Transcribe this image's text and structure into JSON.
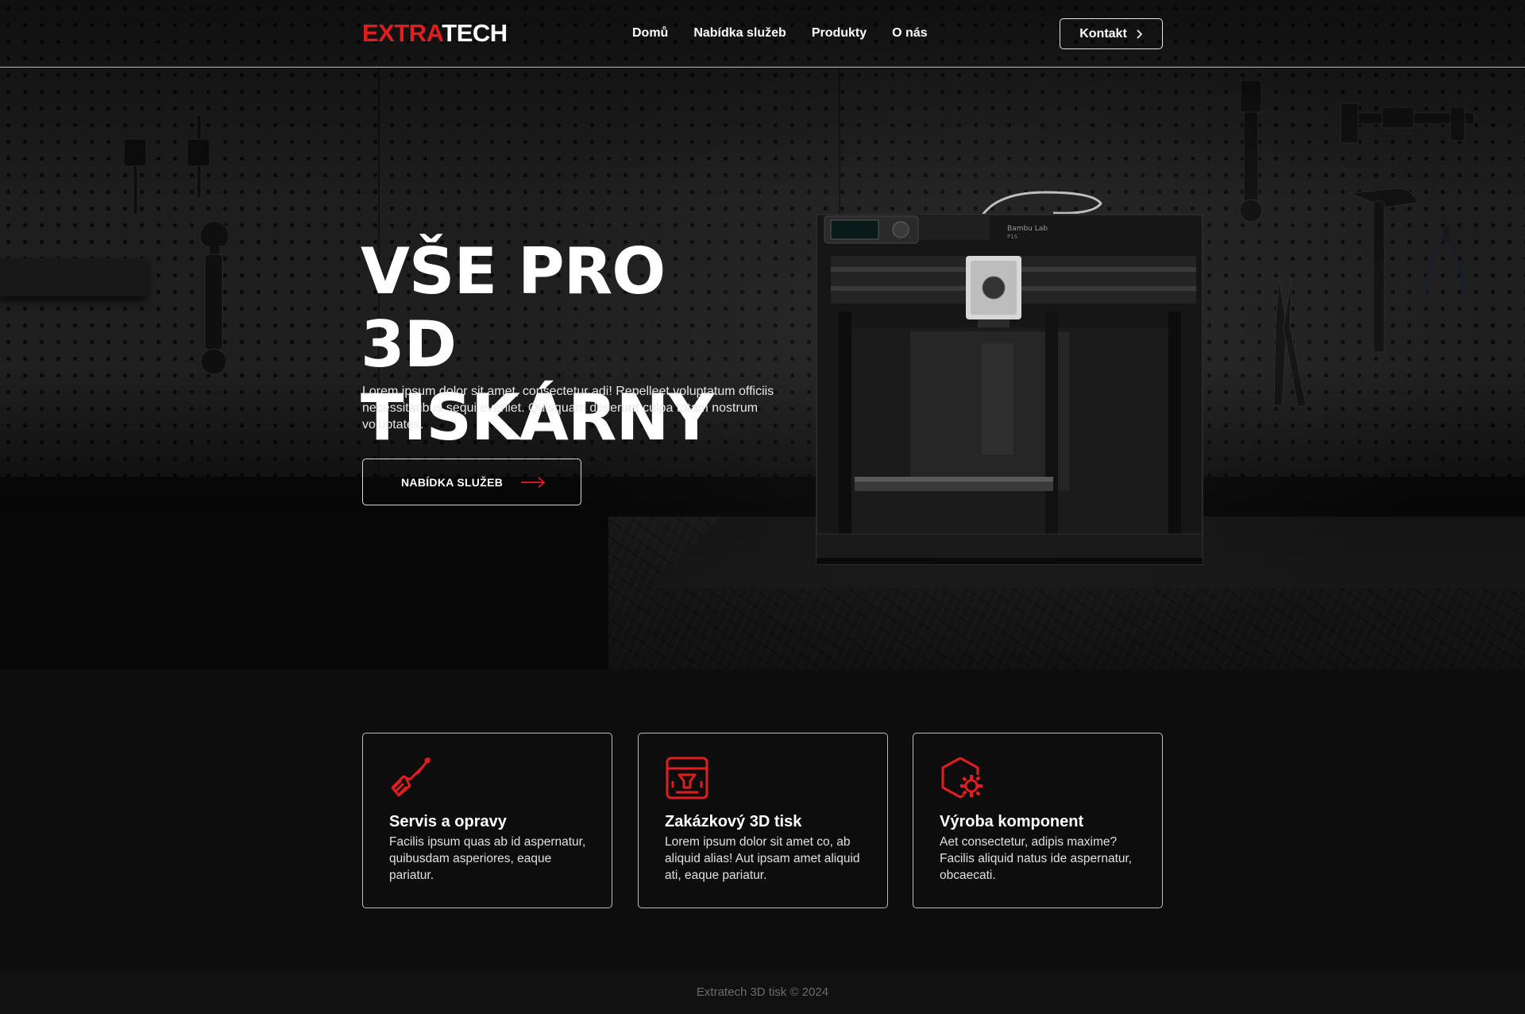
{
  "brand": {
    "logo_part1": "EXTRA",
    "logo_part2": "TECH",
    "accent_color": "#e01e1e"
  },
  "nav": {
    "items": [
      {
        "label": "Domů"
      },
      {
        "label": "Nabídka služeb"
      },
      {
        "label": "Produkty"
      },
      {
        "label": "O nás"
      }
    ],
    "contact_label": "Kontakt",
    "contact_icon": "chevron-right-icon"
  },
  "hero": {
    "title": "VŠE PRO 3D TISKÁRNY",
    "text": "Lorem ipsum dolor sit amet, consectetur adi! Repelleet voluptatum officiis necessitatibus sequi eveniet. Quisquam deserunt culpa totam nostrum voluptates.",
    "button_label": "NABÍDKA SLUŽEB",
    "button_icon": "arrow-right-icon",
    "printer_brand": "Bambu Lab",
    "printer_model": "P1S"
  },
  "features": [
    {
      "icon": "screwdriver-icon",
      "title": "Servis a opravy",
      "text": "Facilis ipsum quas ab id aspernatur, quibusdam asperiores, eaque pariatur."
    },
    {
      "icon": "3d-printer-icon",
      "title": "Zakázkový 3D tisk",
      "text": "Lorem ipsum dolor sit amet co, ab aliquid alias! Aut ipsam amet aliquid ati, eaque pariatur."
    },
    {
      "icon": "hexagon-gear-icon",
      "title": "Výroba komponent",
      "text": "Aet consectetur, adipis maxime? Facilis aliquid natus ide aspernatur, obcaecati."
    }
  ],
  "footer": {
    "text": "Extratech 3D tisk © 2024"
  }
}
